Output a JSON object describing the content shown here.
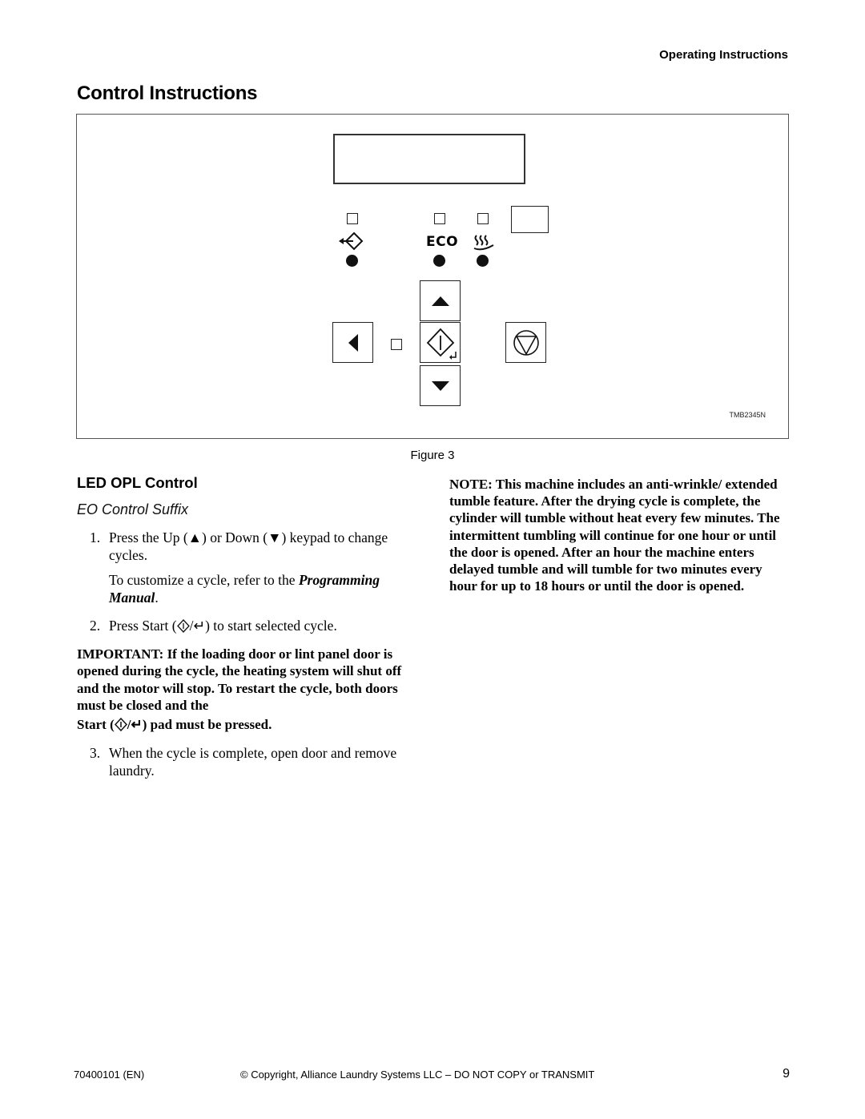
{
  "header": {
    "running_head": "Operating Instructions",
    "page_title": "Control Instructions"
  },
  "figure": {
    "panel": {
      "indicators": [
        {
          "name": "start-delay",
          "icon": "start-with-arrow-icon"
        },
        {
          "name": "eco",
          "label": "ECO"
        },
        {
          "name": "heat",
          "icon": "heat-waves-icon"
        }
      ],
      "keys": [
        "left-arrow-key",
        "up-arrow-key",
        "start-enter-key",
        "down-arrow-key",
        "stop-key"
      ]
    },
    "figure_id": "TMB2345N",
    "caption": "Figure 3"
  },
  "left_column": {
    "section_title": "LED OPL Control",
    "subsection_title": "EO Control Suffix",
    "steps": [
      {
        "number": "1.",
        "text_a": "Press the Up (",
        "up_glyph": "▲",
        "text_b": ") or Down (",
        "down_glyph": "▼",
        "text_c": ") keypad to change cycles."
      },
      {
        "number": "2.",
        "text_a": "Press Start (",
        "text_b": "/↵) to start selected cycle."
      },
      {
        "number": "3.",
        "text": "When the cycle is complete, open door and remove laundry."
      }
    ],
    "step1_sub": {
      "text_a": "To customize a cycle, refer to the ",
      "emphasis": "Programming Manual",
      "text_b": "."
    },
    "important": {
      "text_a": "IMPORTANT: If the loading door or lint panel door is opened during the cycle, the heating system will shut off and the motor will stop. To restart the cycle, both doors must be closed and the",
      "text_b": "Start (",
      "text_c": "/↵) pad must be pressed."
    }
  },
  "right_column": {
    "note": "NOTE: This machine includes an anti-wrinkle/ extended tumble feature. After the drying cycle is complete, the cylinder will tumble without heat every few minutes. The intermittent tumbling will continue for one hour or until the door is opened. After an hour the machine enters delayed tumble and will tumble for two minutes every hour for up to 18 hours or until the door is opened."
  },
  "footer": {
    "doc_code": "70400101 (EN)",
    "copyright": "© Copyright, Alliance Laundry Systems LLC – DO NOT COPY or TRANSMIT",
    "page_number": "9"
  }
}
